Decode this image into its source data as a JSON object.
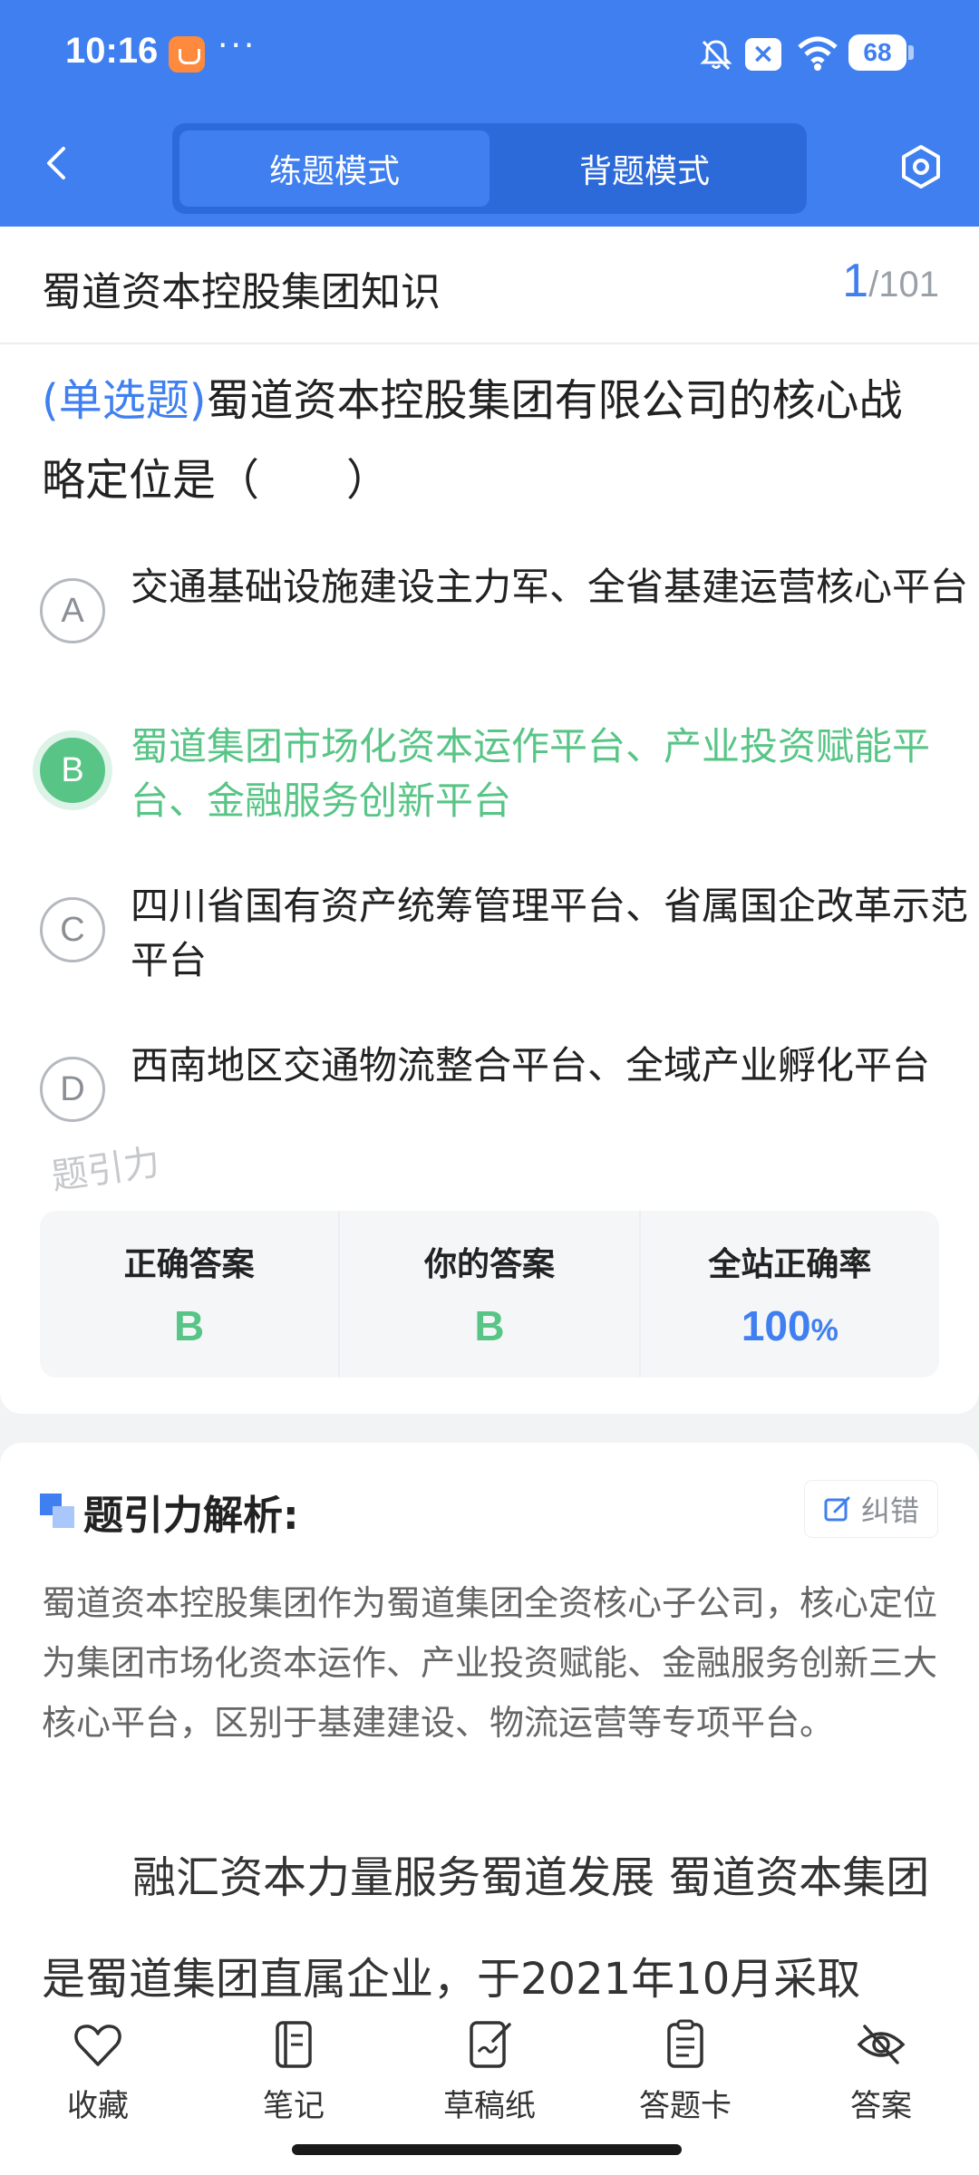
{
  "status_bar": {
    "time": "10:16",
    "dots": "···",
    "battery": "68"
  },
  "nav": {
    "tabs": [
      {
        "label": "练题模式",
        "active": true
      },
      {
        "label": "背题模式",
        "active": false
      }
    ]
  },
  "question": {
    "category": "蜀道资本控股集团知识",
    "current": "1",
    "total": "/101",
    "type_label": "(单选题)",
    "text": "蜀道资本控股集团有限公司的核心战略定位是（　　）",
    "options": [
      {
        "letter": "A",
        "text": "交通基础设施建设主力军、全省基建运营核心平台",
        "state": "normal"
      },
      {
        "letter": "B",
        "text": "蜀道集团市场化资本运作平台、产业投资赋能平台、金融服务创新平台",
        "state": "correct"
      },
      {
        "letter": "C",
        "text": "四川省国有资产统筹管理平台、省属国企改革示范平台",
        "state": "normal"
      },
      {
        "letter": "D",
        "text": "西南地区交通物流整合平台、全域产业孵化平台",
        "state": "normal"
      }
    ],
    "watermark": "题引力"
  },
  "result": {
    "correct_label": "正确答案",
    "correct_value": "B",
    "yours_label": "你的答案",
    "yours_value": "B",
    "rate_label": "全站正确率",
    "rate_value": "100",
    "rate_unit": "%"
  },
  "analysis": {
    "title": "题引力解析:",
    "report_label": "纠错",
    "text": "蜀道资本控股集团作为蜀道集团全资核心子公司，核心定位为集团市场化资本运作、产业投资赋能、金融服务创新三大核心平台，区别于基建建设、物流运营等专项平台。",
    "extra": "融汇资本力量服务蜀道发展 蜀道资本集团是蜀道集团直属企业，于2021年10月采取"
  },
  "toolbar": [
    {
      "label": "收藏",
      "icon": "heart-icon"
    },
    {
      "label": "笔记",
      "icon": "notebook-icon"
    },
    {
      "label": "草稿纸",
      "icon": "draft-icon"
    },
    {
      "label": "答题卡",
      "icon": "answer-sheet-icon"
    },
    {
      "label": "答案",
      "icon": "eye-off-icon"
    }
  ],
  "colors": {
    "primary": "#3f7ff0",
    "correct": "#58c586"
  }
}
